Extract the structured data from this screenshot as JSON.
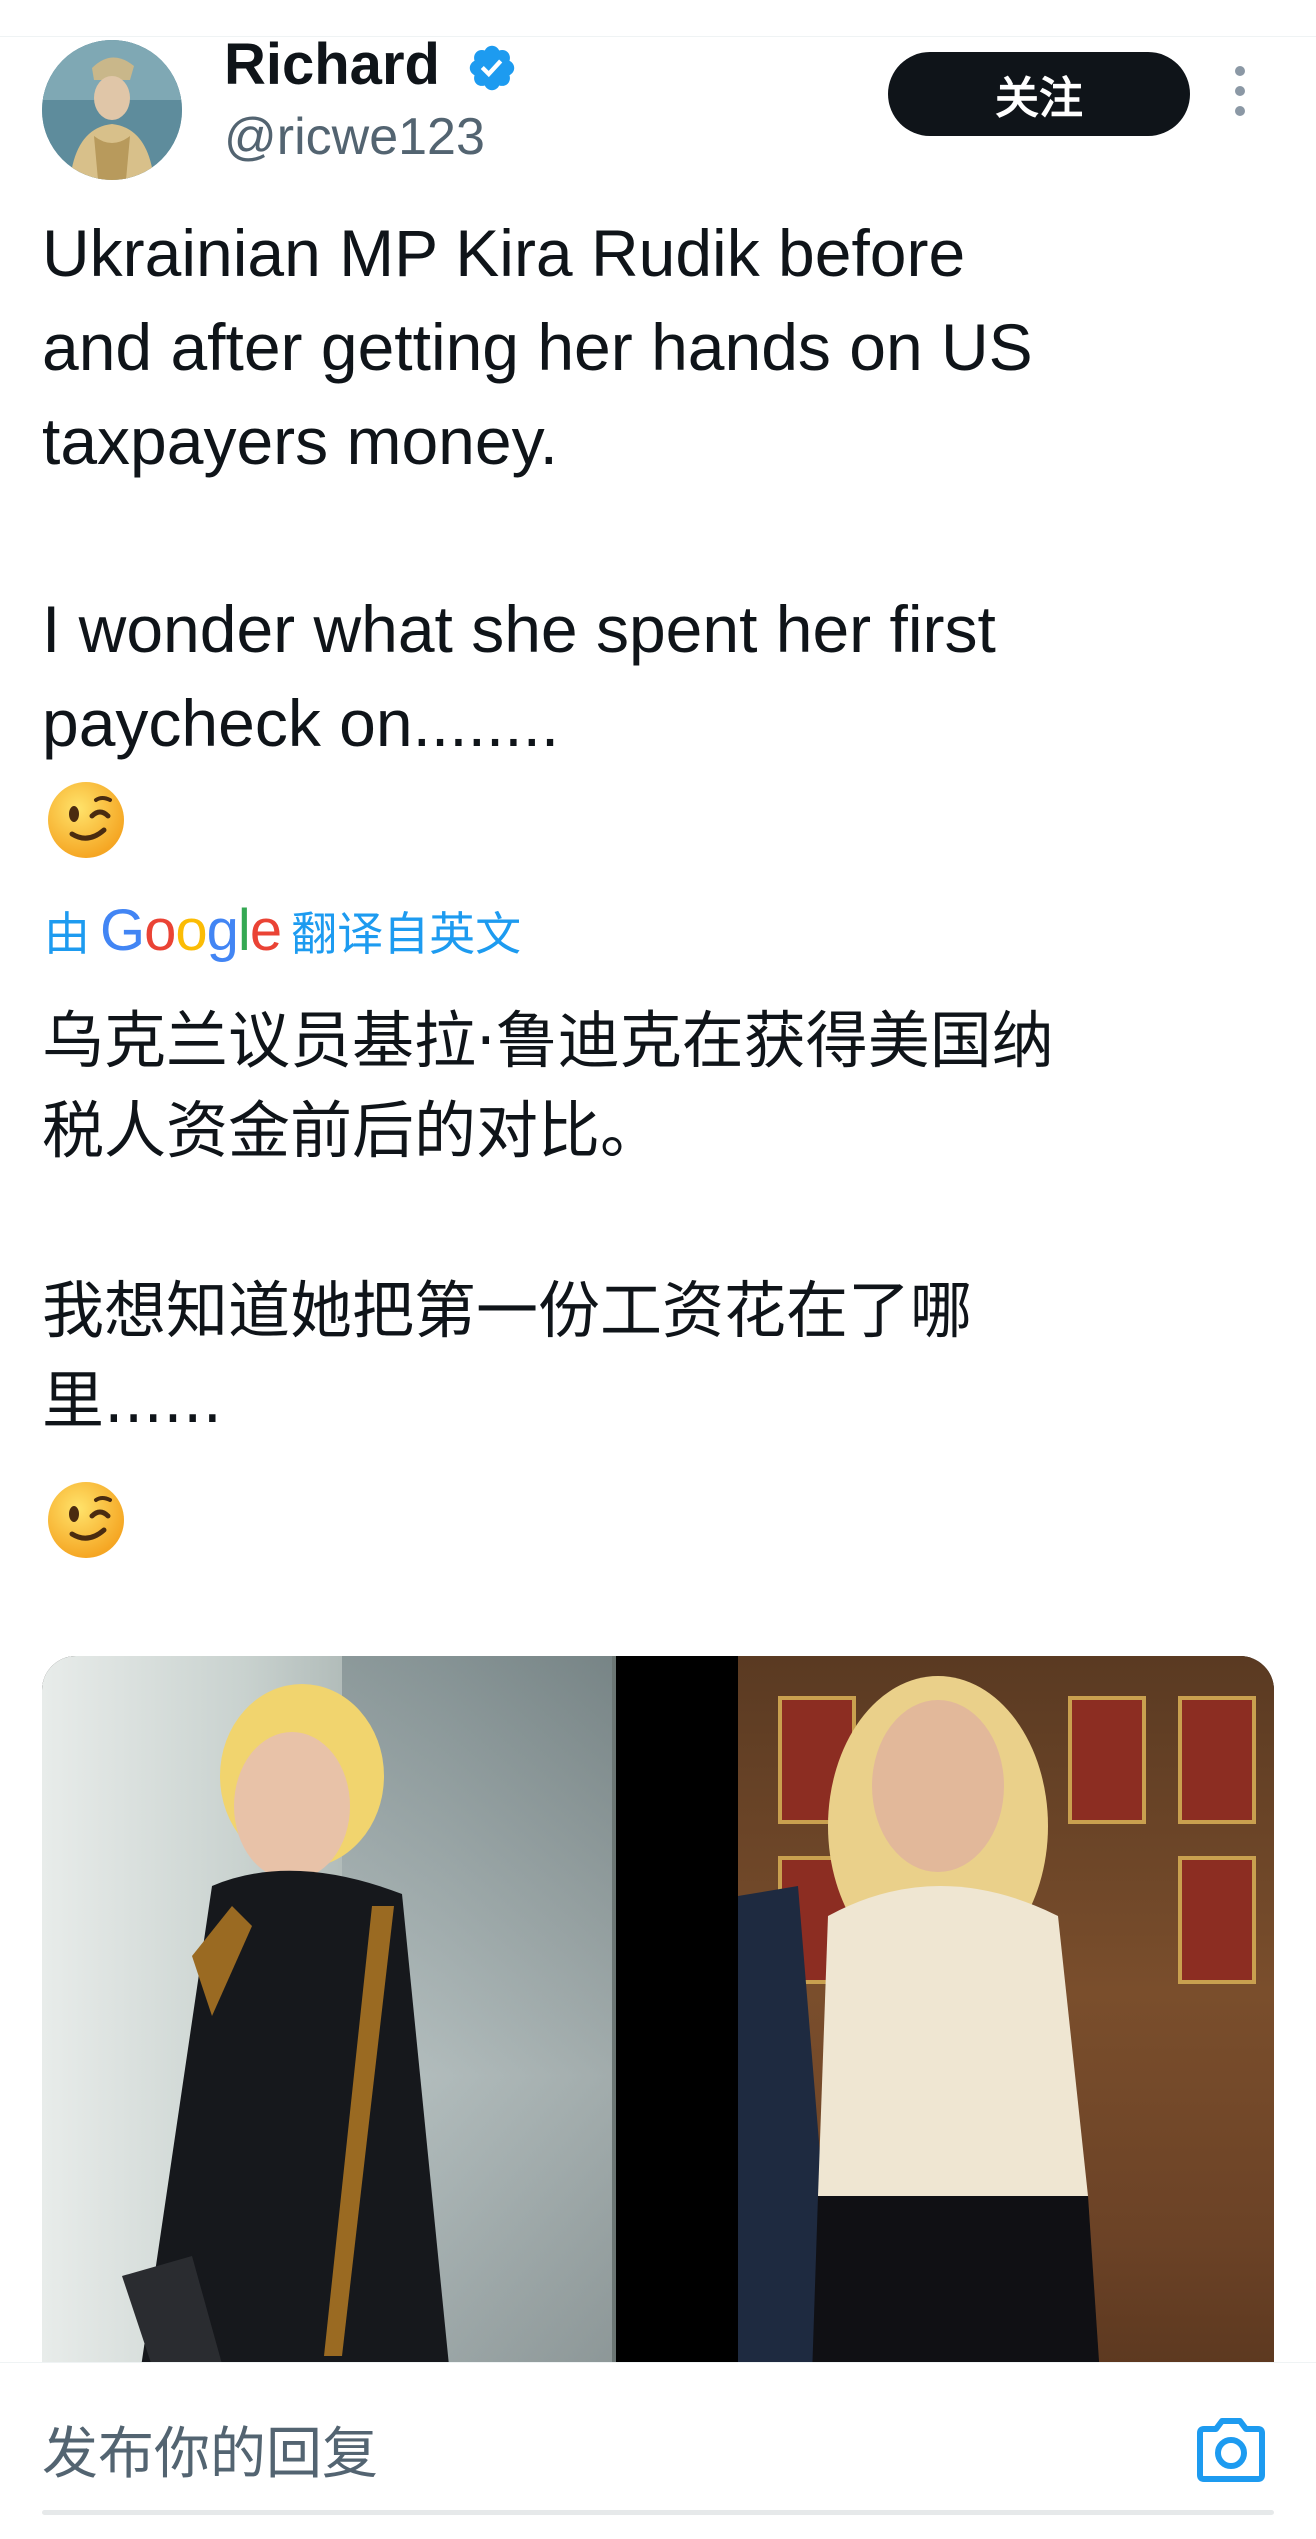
{
  "author": {
    "display_name": "Richard",
    "handle": "@ricwe123",
    "verified": true,
    "avatar_icon": "portrait-avatar"
  },
  "actions": {
    "follow_label": "关注",
    "more_icon": "more-vertical-icon"
  },
  "tweet": {
    "text": "Ukrainian MP Kira Rudik before\nand after getting her hands on US\ntaxpayers money.\n\nI wonder what she spent her first\npaycheck on........",
    "emoji": "😉"
  },
  "translation": {
    "prefix": "由",
    "provider": "Google",
    "suffix": "翻译自英文",
    "text": "乌克兰议员基拉·鲁迪克在获得美国纳\n税人资金前后的对比。\n\n我想知道她把第一份工资花在了哪\n里......",
    "emoji": "😉"
  },
  "media": {
    "layout": "two-photo-collage"
  },
  "reply": {
    "placeholder": "发布你的回复",
    "camera_icon": "camera-icon"
  },
  "colors": {
    "accent": "#1d9bf0",
    "text": "#0f1419",
    "secondary": "#536471",
    "follow_bg": "#0f1419"
  }
}
